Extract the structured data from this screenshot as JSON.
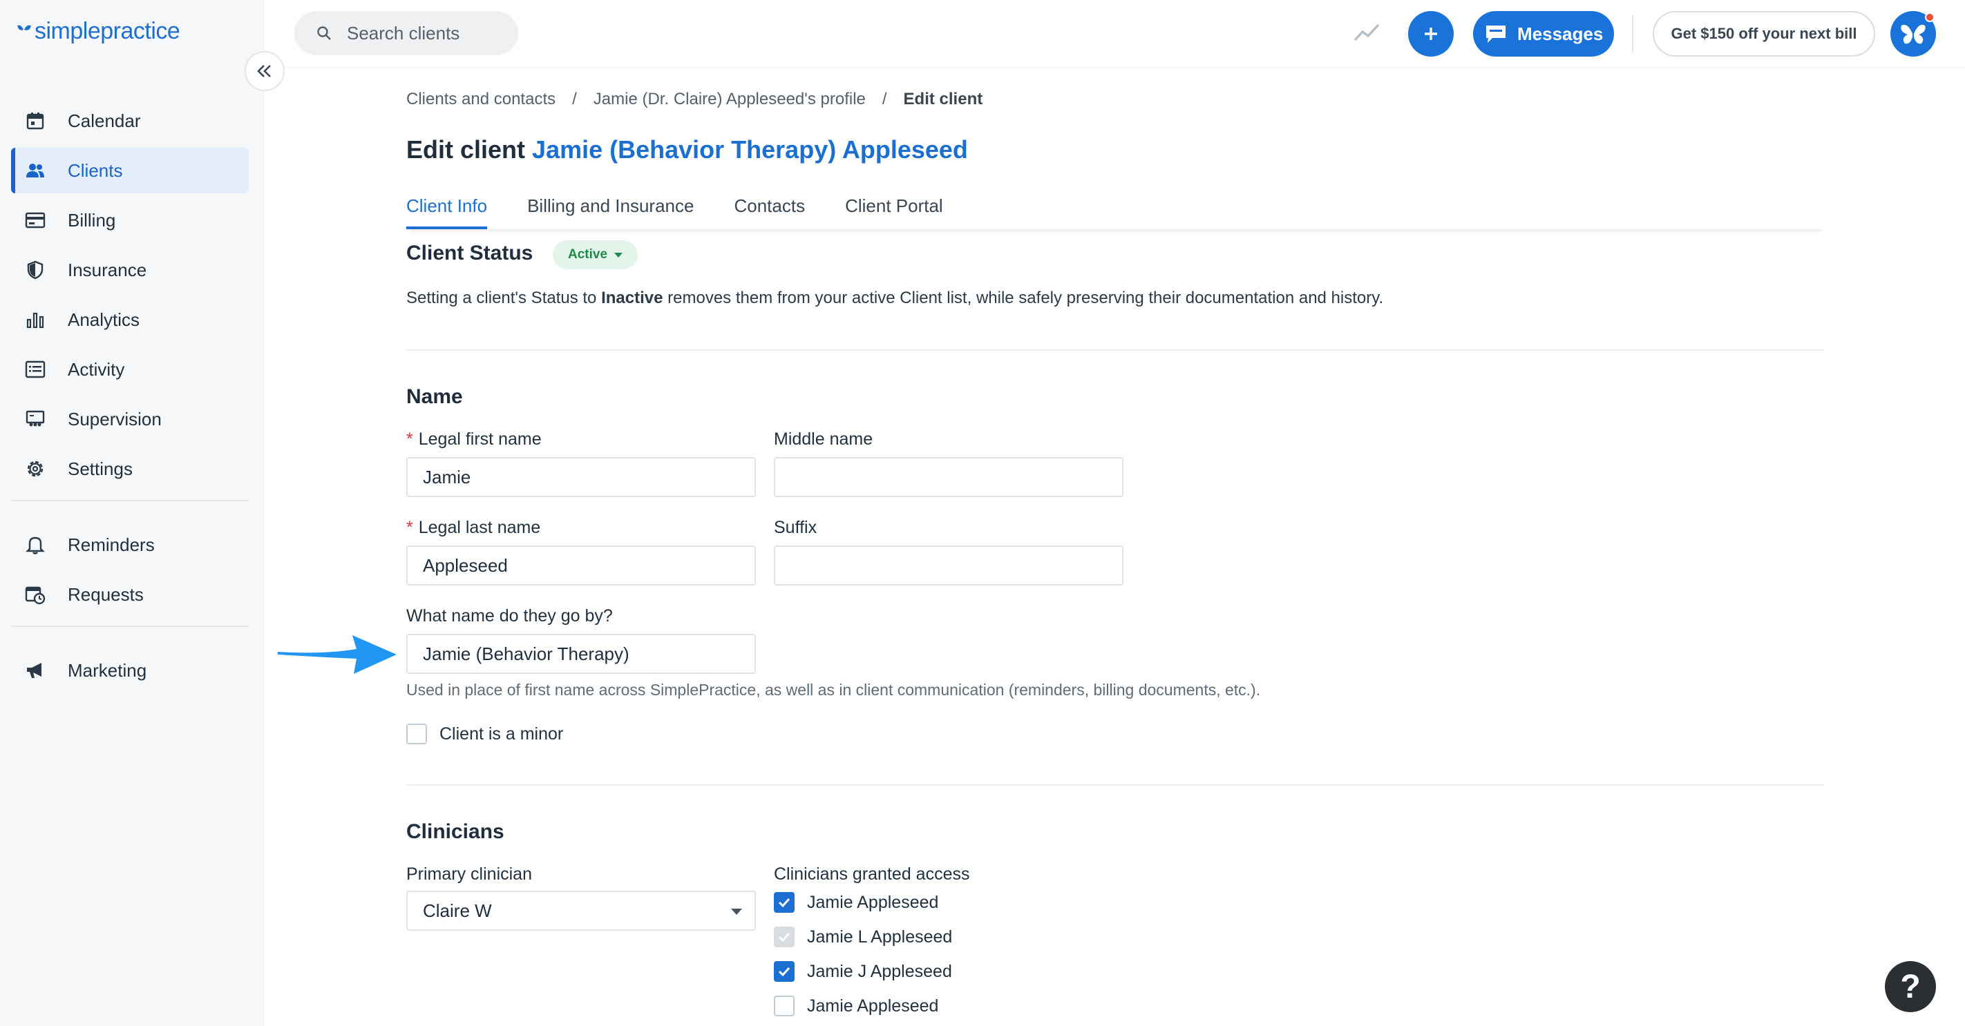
{
  "app": {
    "logo_text": "simplepractice"
  },
  "sidebar": {
    "items": [
      {
        "label": "Calendar",
        "icon": "calendar-icon"
      },
      {
        "label": "Clients",
        "icon": "users-icon",
        "active": true
      },
      {
        "label": "Billing",
        "icon": "credit-card-icon"
      },
      {
        "label": "Insurance",
        "icon": "shield-icon"
      },
      {
        "label": "Analytics",
        "icon": "bar-chart-icon"
      },
      {
        "label": "Activity",
        "icon": "list-icon"
      },
      {
        "label": "Supervision",
        "icon": "supervision-icon"
      },
      {
        "label": "Settings",
        "icon": "gear-icon"
      }
    ],
    "secondary_items": [
      {
        "label": "Reminders",
        "icon": "bell-icon"
      },
      {
        "label": "Requests",
        "icon": "calendar-clock-icon"
      }
    ],
    "tertiary_items": [
      {
        "label": "Marketing",
        "icon": "megaphone-icon"
      }
    ]
  },
  "topbar": {
    "search_placeholder": "Search clients",
    "messages_label": "Messages",
    "promo_label": "Get $150 off your next bill"
  },
  "breadcrumb": {
    "items": [
      "Clients and contacts",
      "Jamie (Dr. Claire) Appleseed's profile"
    ],
    "current": "Edit client",
    "separator": "/"
  },
  "page": {
    "title_prefix": "Edit client",
    "client_name": "Jamie (Behavior Therapy) Appleseed"
  },
  "tabs": [
    {
      "label": "Client Info",
      "active": true
    },
    {
      "label": "Billing and Insurance"
    },
    {
      "label": "Contacts"
    },
    {
      "label": "Client Portal"
    }
  ],
  "status": {
    "heading": "Client Status",
    "badge": "Active",
    "text_before": "Setting a client's Status to ",
    "text_bold": "Inactive",
    "text_after": " removes them from your active Client list, while safely preserving their documentation and history."
  },
  "name_section": {
    "heading": "Name",
    "required_mark": "*",
    "first_name_label": "Legal first name",
    "first_name_value": "Jamie",
    "middle_name_label": "Middle name",
    "middle_name_value": "",
    "last_name_label": "Legal last name",
    "last_name_value": "Appleseed",
    "suffix_label": "Suffix",
    "suffix_value": "",
    "goes_by_label": "What name do they go by?",
    "goes_by_value": "Jamie (Behavior Therapy)",
    "goes_by_helper": "Used in place of first name across SimplePractice, as well as in client communication (reminders, billing documents, etc.).",
    "minor_label": "Client is a minor"
  },
  "clinicians": {
    "heading": "Clinicians",
    "primary_label": "Primary clinician",
    "primary_value": "Claire W",
    "access_label": "Clinicians granted access",
    "access_list": [
      {
        "name": "Jamie Appleseed",
        "state": "checked"
      },
      {
        "name": "Jamie L Appleseed",
        "state": "disabled"
      },
      {
        "name": "Jamie J Appleseed",
        "state": "checked"
      },
      {
        "name": "Jamie Appleseed",
        "state": "unchecked"
      }
    ]
  },
  "help": {
    "label": "?"
  },
  "colors": {
    "brand": "#1a6fd1",
    "active_badge_bg": "#e3f5ea",
    "active_badge_text": "#1d8a4a",
    "arrow": "#2196f3"
  }
}
